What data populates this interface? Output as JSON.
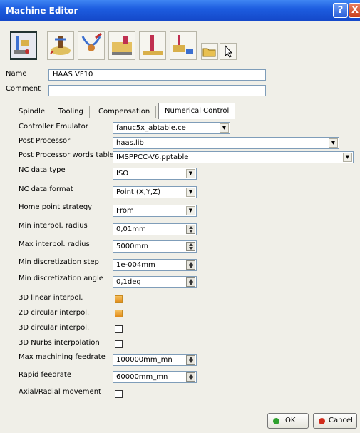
{
  "window": {
    "title": "Machine Editor"
  },
  "titlebar_buttons": {
    "help": "?",
    "close": "X"
  },
  "toolbar": {
    "icons": [
      "machine-3axis-icon",
      "machine-3axis-table-icon",
      "machine-5axis-icon",
      "lathe-machine-icon",
      "machine-spindle-icon",
      "mill-turn-machine-icon",
      "open-folder-icon",
      "select-cursor-icon"
    ]
  },
  "fields": {
    "name_label": "Name",
    "name_value": "HAAS VF10",
    "comment_label": "Comment",
    "comment_value": ""
  },
  "tabs": [
    "Spindle",
    "Tooling",
    "Compensation",
    "Numerical Control"
  ],
  "active_tab": "Numerical Control",
  "nc": {
    "controller_emulator": {
      "label": "Controller Emulator",
      "value": "fanuc5x_abtable.ce"
    },
    "post_processor": {
      "label": "Post Processor",
      "value": "haas.lib"
    },
    "pp_words_table": {
      "label": "Post Processor words table",
      "value": "IMSPPCC-V6.pptable"
    },
    "nc_data_type": {
      "label": "NC data type",
      "value": "ISO"
    },
    "nc_data_format": {
      "label": "NC data format",
      "value": "Point (X,Y,Z)"
    },
    "home_point_strategy": {
      "label": "Home point strategy",
      "value": "From"
    },
    "min_interpol_radius": {
      "label": "Min interpol. radius",
      "value": "0,01mm"
    },
    "max_interpol_radius": {
      "label": "Max interpol. radius",
      "value": "5000mm"
    },
    "min_discretization_step": {
      "label": "Min discretization step",
      "value": "1e-004mm"
    },
    "min_discretization_angle": {
      "label": "Min discretization angle",
      "value": "0,1deg"
    },
    "linear_3d": {
      "label": "3D linear interpol.",
      "checked": true
    },
    "circular_2d": {
      "label": "2D circular interpol.",
      "checked": true
    },
    "circular_3d": {
      "label": "3D circular interpol.",
      "checked": false
    },
    "nurbs_3d": {
      "label": "3D Nurbs interpolation",
      "checked": false
    },
    "max_machining_feedrate": {
      "label": "Max machining feedrate",
      "value": "100000mm_mn"
    },
    "rapid_feedrate": {
      "label": "Rapid feedrate",
      "value": "60000mm_mn"
    },
    "axial_radial": {
      "label": "Axial/Radial movement",
      "checked": false
    }
  },
  "footer": {
    "ok_label": "OK",
    "cancel_label": "Cancel"
  },
  "colors": {
    "titlebar": "#1d5de0",
    "ok_dot": "#2ea02e",
    "cancel_dot": "#d02a1a",
    "checkbox_on": "#e08a18"
  }
}
